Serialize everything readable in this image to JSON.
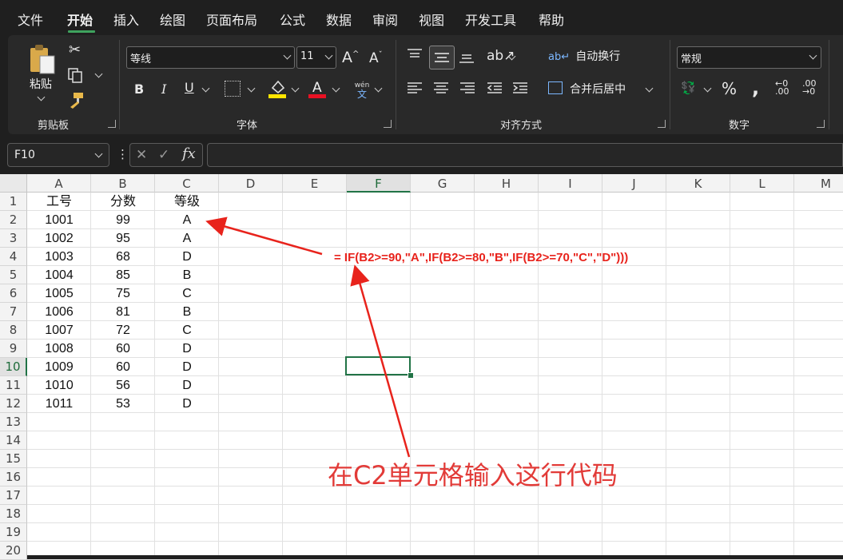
{
  "menu": {
    "tabs": [
      "文件",
      "开始",
      "插入",
      "绘图",
      "页面布局",
      "公式",
      "数据",
      "审阅",
      "视图",
      "开发工具",
      "帮助"
    ],
    "active_tab": "开始"
  },
  "ribbon": {
    "clipboard": {
      "label": "剪贴板",
      "paste": "粘贴"
    },
    "font": {
      "label": "字体",
      "font_name": "等线",
      "font_size": "11",
      "wen_glyph": "wén",
      "wen_char": "文"
    },
    "alignment": {
      "label": "对齐方式",
      "wrap_text": "自动换行",
      "merge_center": "合并后居中"
    },
    "number": {
      "label": "数字",
      "format": "常规"
    }
  },
  "name_box": "F10",
  "formula_bar": {
    "value": ""
  },
  "columns": [
    "A",
    "B",
    "C",
    "D",
    "E",
    "F",
    "G",
    "H",
    "I",
    "J",
    "K",
    "L",
    "M"
  ],
  "rows": [
    "1",
    "2",
    "3",
    "4",
    "5",
    "6",
    "7",
    "8",
    "9",
    "10",
    "11",
    "12",
    "13",
    "14",
    "15",
    "16",
    "17",
    "18",
    "19",
    "20"
  ],
  "selected": {
    "column": "F",
    "row": "10"
  },
  "sheet": {
    "headers": [
      "工号",
      "分数",
      "等级"
    ],
    "data": [
      [
        "1001",
        "99",
        "A"
      ],
      [
        "1002",
        "95",
        "A"
      ],
      [
        "1003",
        "68",
        "D"
      ],
      [
        "1004",
        "85",
        "B"
      ],
      [
        "1005",
        "75",
        "C"
      ],
      [
        "1006",
        "81",
        "B"
      ],
      [
        "1007",
        "72",
        "C"
      ],
      [
        "1008",
        "60",
        "D"
      ],
      [
        "1009",
        "60",
        "D"
      ],
      [
        "1010",
        "56",
        "D"
      ],
      [
        "1011",
        "53",
        "D"
      ]
    ]
  },
  "annotation": {
    "formula": "= IF(B2>=90,\"A\",IF(B2>=80,\"B\",IF(B2>=70,\"C\",\"D\")))",
    "note": "在C2单元格输入这行代码",
    "color": "#e8231c"
  },
  "colors": {
    "accent": "#217346",
    "ribbon_bg": "#292929",
    "app_bg": "#1f1f1f"
  }
}
